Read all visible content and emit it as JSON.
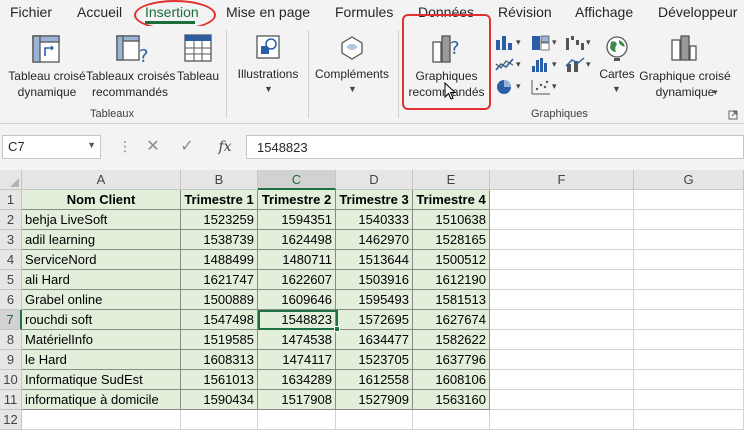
{
  "menu": {
    "tabs": [
      "Fichier",
      "Accueil",
      "Insertion",
      "Mise en page",
      "Formules",
      "Données",
      "Révision",
      "Affichage",
      "Développeur"
    ],
    "active": "Insertion"
  },
  "ribbon": {
    "tableaux": {
      "croise_line1": "Tableau croisé",
      "croise_line2": "dynamique",
      "recommandes_line1": "Tableaux croisés",
      "recommandes_line2": "recommandés",
      "tableau": "Tableau",
      "group": "Tableaux"
    },
    "illustrations": "Illustrations",
    "complements": "Compléments",
    "graphiques": {
      "recommandes_line1": "Graphiques",
      "recommandes_line2": "recommandés",
      "cartes": "Cartes",
      "croise_line1": "Graphique croisé",
      "croise_line2": "dynamique",
      "group": "Graphiques"
    }
  },
  "formula_bar": {
    "name_box": "C7",
    "cancel": "✕",
    "enter": "✓",
    "fx": "fx",
    "value": "1548823"
  },
  "sheet": {
    "columns": [
      "A",
      "B",
      "C",
      "D",
      "E",
      "F",
      "G"
    ],
    "selected_column": "C",
    "selected_row": "7",
    "rows": [
      "1",
      "2",
      "3",
      "4",
      "5",
      "6",
      "7",
      "8",
      "9",
      "10",
      "11",
      "12"
    ],
    "header": [
      "Nom Client",
      "Trimestre 1",
      "Trimestre 2",
      "Trimestre 3",
      "Trimestre 4"
    ],
    "data": [
      [
        "behja LiveSoft",
        "1523259",
        "1594351",
        "1540333",
        "1510638"
      ],
      [
        "adil learning",
        "1538739",
        "1624498",
        "1462970",
        "1528165"
      ],
      [
        "ServiceNord",
        "1488499",
        "1480711",
        "1513644",
        "1500512"
      ],
      [
        "ali Hard",
        "1621747",
        "1622607",
        "1503916",
        "1612190"
      ],
      [
        "Grabel online",
        "1500889",
        "1609646",
        "1595493",
        "1581513"
      ],
      [
        "rouchdi soft",
        "1547498",
        "1548823",
        "1572695",
        "1627674"
      ],
      [
        "MatérielInfo",
        "1519585",
        "1474538",
        "1634477",
        "1582622"
      ],
      [
        "le Hard",
        "1608313",
        "1474117",
        "1523705",
        "1637796"
      ],
      [
        "Informatique SudEst",
        "1561013",
        "1634289",
        "1612558",
        "1608106"
      ],
      [
        "informatique à domicile",
        "1590434",
        "1517908",
        "1527909",
        "1563160"
      ]
    ]
  },
  "colors": {
    "accent": "#1e6b3c",
    "highlight": "#e0322e",
    "table_fill": "#e2efda"
  }
}
